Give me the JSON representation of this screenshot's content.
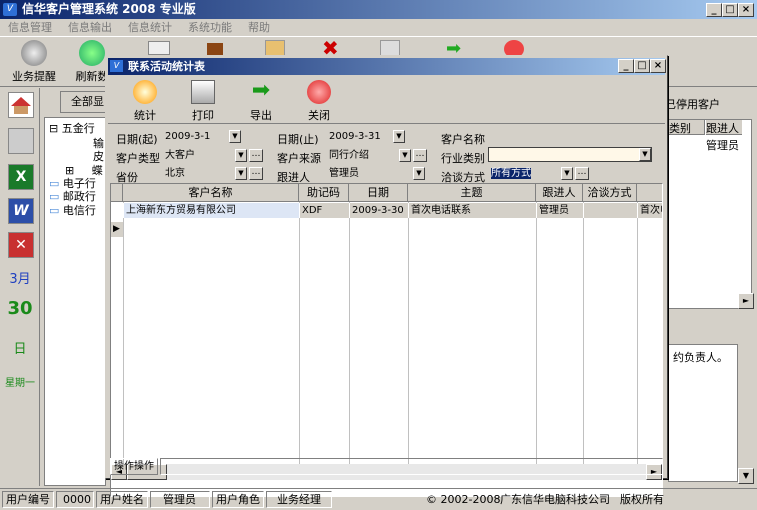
{
  "app": {
    "title": "信华客户管理系统 2008 专业版"
  },
  "menu": [
    "信息管理",
    "信息输出",
    "信息统计",
    "系统功能",
    "帮助"
  ],
  "toolbar": [
    "业务提醒",
    "刷新数"
  ],
  "side": {
    "month": "3月",
    "day": "30",
    "day_label": "日",
    "weekday": "星期一"
  },
  "tree": [
    "五金行",
    "输",
    "皮",
    "蝶",
    "电子行",
    "邮政行",
    "电信行"
  ],
  "bg": {
    "all_btn": "全部显",
    "stopped": "已停用客户",
    "col1": "类别",
    "col2": "跟进人",
    "row_val": "管理员",
    "note": "约负责人。",
    "ops": "操作"
  },
  "dialog": {
    "title": "联系活动统计表",
    "buttons": [
      "统计",
      "打印",
      "导出",
      "关闭"
    ],
    "filters": {
      "date_from_label": "日期(起)",
      "date_from": "2009-3-1",
      "date_to_label": "日期(止)",
      "date_to": "2009-3-31",
      "name_label": "客户名称",
      "type_label": "客户类型",
      "type": "大客户",
      "source_label": "客户来源",
      "source": "同行介绍",
      "industry_label": "行业类别",
      "province_label": "省份",
      "province": "北京",
      "follow_label": "跟进人",
      "follow": "管理员",
      "method_label": "洽谈方式",
      "method": "所有方式"
    },
    "columns": [
      "客户名称",
      "助记码",
      "日期",
      "主题",
      "跟进人",
      "洽谈方式"
    ],
    "rows": [
      {
        "name": "上海新东方贸易有限公司",
        "code": "XDF",
        "date": "2009-3-30",
        "topic": "首次电话联系",
        "person": "管理员",
        "method": "",
        "extra": "首次电"
      }
    ],
    "footer_tab": "操作操作"
  },
  "status": {
    "uid_label": "用户编号",
    "uid": "0000",
    "uname_label": "用户姓名",
    "uname": "管理员",
    "role_label": "用户角色",
    "role": "业务经理",
    "copyright": "© 2002-2008",
    "company": "广东信华电脑科技公司",
    "rights": "版权所有"
  }
}
